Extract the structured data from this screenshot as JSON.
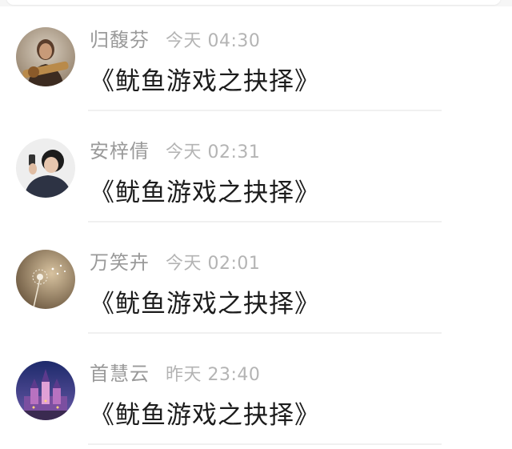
{
  "comments": [
    {
      "author": "归馥芬",
      "time": "今天 04:30",
      "text": "《鱿鱼游戏之抉择》",
      "avatar": "person-with-guitar-avatar"
    },
    {
      "author": "安梓倩",
      "time": "今天 02:31",
      "text": "《鱿鱼游戏之抉择》",
      "avatar": "person-on-phone-avatar"
    },
    {
      "author": "万笑卉",
      "time": "今天 02:01",
      "text": "《鱿鱼游戏之抉择》",
      "avatar": "dandelion-avatar"
    },
    {
      "author": "首慧云",
      "time": "昨天 23:40",
      "text": "《鱿鱼游戏之抉择》",
      "avatar": "castle-night-avatar"
    }
  ],
  "colors": {
    "author": "#9a9a9a",
    "time": "#b4b4b4",
    "text": "#1c1c1c",
    "divider": "#f0f0f0"
  }
}
